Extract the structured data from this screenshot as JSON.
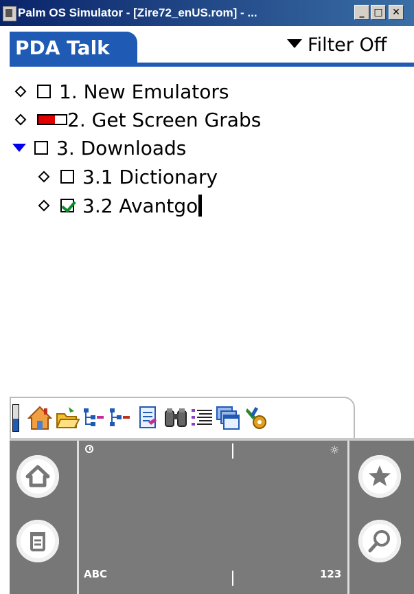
{
  "window": {
    "title": "Palm OS Simulator - [Zire72_enUS.rom] - ...",
    "controls": [
      "minimize",
      "maximize",
      "close"
    ]
  },
  "app": {
    "title": "PDA Talk",
    "filter_label": "Filter Off"
  },
  "tasks": [
    {
      "label": "1. New Emulators",
      "expander": "diamond",
      "state": "unchecked"
    },
    {
      "label": "2. Get Screen Grabs",
      "expander": "diamond",
      "state": "progress",
      "progress": 0.6
    },
    {
      "label": "3. Downloads",
      "expander": "expanded-triangle",
      "state": "unchecked"
    },
    {
      "label": "3.1 Dictionary",
      "expander": "diamond",
      "state": "unchecked"
    },
    {
      "label": "3.2 Avantgo",
      "expander": "diamond",
      "state": "checked"
    }
  ],
  "toolbar": {
    "icons": [
      "battery-icon",
      "home-icon",
      "open-folder-icon",
      "outline-indent-icon",
      "outline-outdent-icon",
      "note-icon",
      "binoculars-icon",
      "list-icon",
      "windows-icon",
      "tools-icon"
    ]
  },
  "graffiti": {
    "abc_label": "ABC",
    "num_label": "123",
    "left_buttons": [
      "home-icon",
      "menu-icon"
    ],
    "right_buttons": [
      "favorites-star-icon",
      "find-icon"
    ]
  },
  "colors": {
    "accent": "#1f5ab4",
    "progress_fill": "#e00000",
    "check": "#0a8a2a",
    "expand_triangle": "#0000ee"
  }
}
